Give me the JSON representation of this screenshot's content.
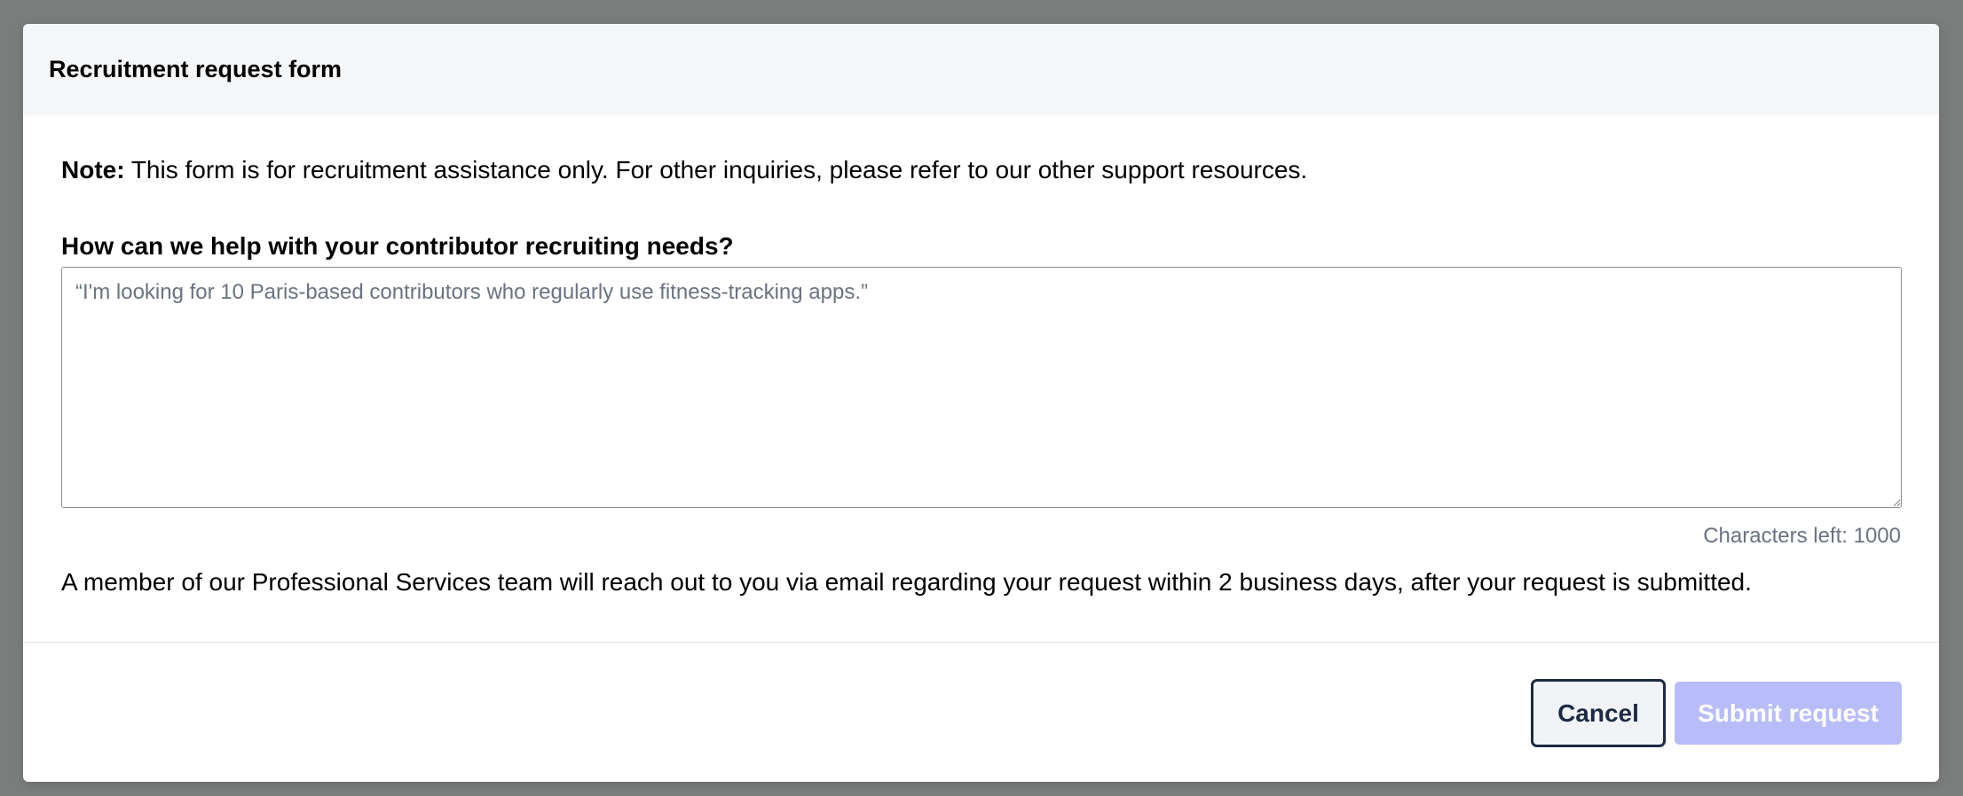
{
  "modal": {
    "title": "Recruitment request form"
  },
  "note": {
    "label": "Note:",
    "text": " This form is for recruitment assistance only. For other inquiries, please refer to our other support resources."
  },
  "question": {
    "label": "How can we help with your contributor recruiting needs?",
    "placeholder": "“I'm looking for 10 Paris-based contributors who regularly use fitness-tracking apps.”",
    "value": ""
  },
  "chars_left": "Characters left: 1000",
  "info_text": "A member of our Professional Services team will reach out to you via email regarding your request within 2 business days, after your request is submitted.",
  "actions": {
    "cancel_label": "Cancel",
    "submit_label": "Submit request"
  },
  "colors": {
    "overlay": "#7b7d7c",
    "header_bg": "#f5f6f8",
    "cancel_border": "#1d2a44",
    "submit_disabled_bg": "#b8bdf9",
    "muted_text": "#6b7280"
  }
}
